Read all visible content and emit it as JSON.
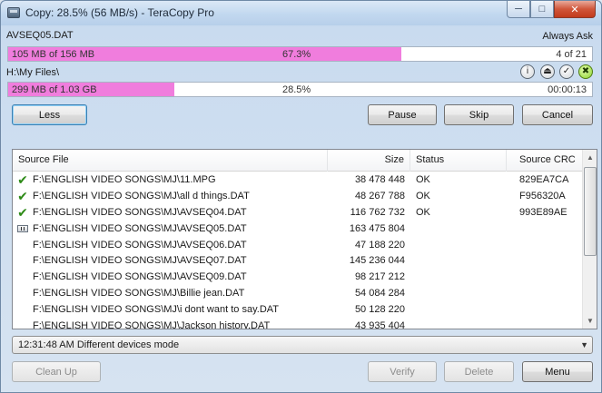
{
  "window": {
    "title": "Copy: 28.5%  (56 MB/s) - TeraCopy Pro",
    "min_glyph": "─",
    "max_glyph": "□",
    "close_glyph": "✕"
  },
  "current_file": {
    "name": "AVSEQ05.DAT",
    "action": "Always Ask",
    "progress_text": "105 MB of 156 MB",
    "percent_text": "67.3%",
    "percent": 67.3,
    "file_index": "4 of 21"
  },
  "total": {
    "target_path": "H:\\My Files\\",
    "progress_text": "299 MB of 1.03 GB",
    "percent_text": "28.5%",
    "percent": 28.5,
    "elapsed": "00:00:13"
  },
  "status_icons": {
    "info_glyph": "i",
    "eject_glyph": "⏏",
    "check_glyph": "✓",
    "close_glyph": "✖"
  },
  "buttons": {
    "less": "Less",
    "pause": "Pause",
    "skip": "Skip",
    "cancel": "Cancel",
    "clean_up": "Clean Up",
    "verify": "Verify",
    "delete": "Delete",
    "menu": "Menu"
  },
  "list": {
    "columns": [
      "Source File",
      "Size",
      "Status",
      "Source CRC"
    ],
    "rows": [
      {
        "icon": "check",
        "file": "F:\\ENGLISH VIDEO SONGS\\MJ\\11.MPG",
        "size": "38 478 448",
        "status": "OK",
        "crc": "829EA7CA"
      },
      {
        "icon": "check",
        "file": "F:\\ENGLISH VIDEO SONGS\\MJ\\all d things.DAT",
        "size": "48 267 788",
        "status": "OK",
        "crc": "F956320A"
      },
      {
        "icon": "check",
        "file": "F:\\ENGLISH VIDEO SONGS\\MJ\\AVSEQ04.DAT",
        "size": "116 762 732",
        "status": "OK",
        "crc": "993E89AE"
      },
      {
        "icon": "in-progress",
        "file": "F:\\ENGLISH VIDEO SONGS\\MJ\\AVSEQ05.DAT",
        "size": "163 475 804",
        "status": "",
        "crc": ""
      },
      {
        "icon": "",
        "file": "F:\\ENGLISH VIDEO SONGS\\MJ\\AVSEQ06.DAT",
        "size": "47 188 220",
        "status": "",
        "crc": ""
      },
      {
        "icon": "",
        "file": "F:\\ENGLISH VIDEO SONGS\\MJ\\AVSEQ07.DAT",
        "size": "145 236 044",
        "status": "",
        "crc": ""
      },
      {
        "icon": "",
        "file": "F:\\ENGLISH VIDEO SONGS\\MJ\\AVSEQ09.DAT",
        "size": "98 217 212",
        "status": "",
        "crc": ""
      },
      {
        "icon": "",
        "file": "F:\\ENGLISH VIDEO SONGS\\MJ\\Billie jean.DAT",
        "size": "54 084 284",
        "status": "",
        "crc": ""
      },
      {
        "icon": "",
        "file": "F:\\ENGLISH VIDEO SONGS\\MJ\\i dont want to say.DAT",
        "size": "50 128 220",
        "status": "",
        "crc": ""
      },
      {
        "icon": "",
        "file": "F:\\ENGLISH VIDEO SONGS\\MJ\\Jackson history.DAT",
        "size": "43 935 404",
        "status": "",
        "crc": ""
      }
    ]
  },
  "log": {
    "selected": "12:31:48 AM Different devices mode"
  },
  "colors": {
    "progress_fill": "#f07ddd",
    "ok_check": "#2d8a16"
  }
}
